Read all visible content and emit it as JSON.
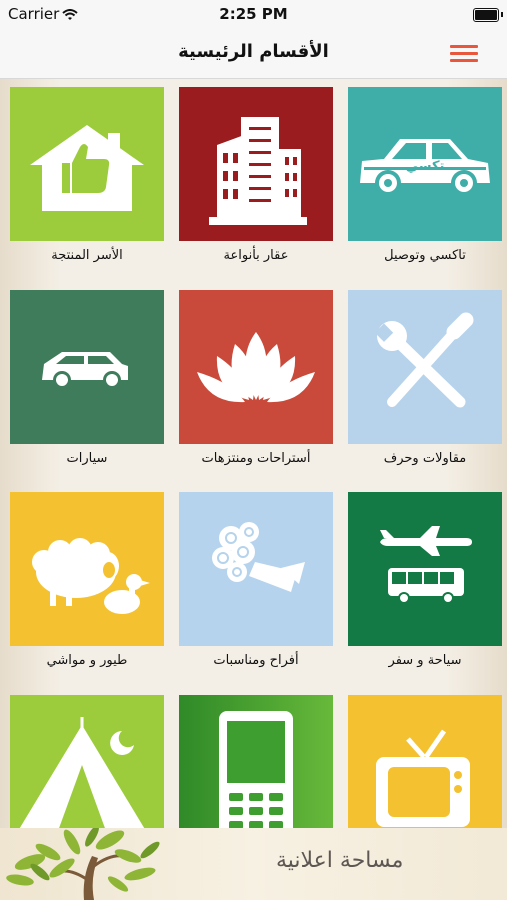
{
  "status_bar": {
    "carrier": "Carrier",
    "time": "2:25 PM"
  },
  "nav": {
    "title": "الأقسام الرئيسية",
    "menu_icon": "hamburger-menu-icon",
    "menu_color": "#e8573c"
  },
  "categories": [
    {
      "label": "تاكسي وتوصيل",
      "icon": "taxi-icon",
      "color": "#3fada8",
      "icon_text": "تكسي"
    },
    {
      "label": "عقار بأنواعة",
      "icon": "building-icon",
      "color": "#9b1c1f"
    },
    {
      "label": "الأسر المنتجة",
      "icon": "home-thumbs-up-icon",
      "color": "#9ccc3c"
    },
    {
      "label": "مقاولات وحرف",
      "icon": "wrench-screwdriver-icon",
      "color": "#b7d3ec"
    },
    {
      "label": "أستراحات ومنتزهات",
      "icon": "lotus-icon",
      "color": "#c94a3a"
    },
    {
      "label": "سيارات",
      "icon": "car-icon",
      "color": "#3f7c5c"
    },
    {
      "label": "سياحة و سفر",
      "icon": "plane-bus-icon",
      "color": "#137a45"
    },
    {
      "label": "أفراح ومناسبات",
      "icon": "flower-bouquet-icon",
      "color": "#b5d3ec"
    },
    {
      "label": "طيور و مواشي",
      "icon": "sheep-duck-icon",
      "color": "#f4c130"
    },
    {
      "label": "",
      "icon": "tv-icon",
      "color": "#f4c130"
    },
    {
      "label": "",
      "icon": "mobile-phone-icon",
      "color": "#3e9e2f"
    },
    {
      "label": "",
      "icon": "tent-moon-icon",
      "color": "#9ccc3c"
    }
  ],
  "ad_banner": {
    "text": "مساحة اعلانية",
    "icon": "tree-icon"
  }
}
